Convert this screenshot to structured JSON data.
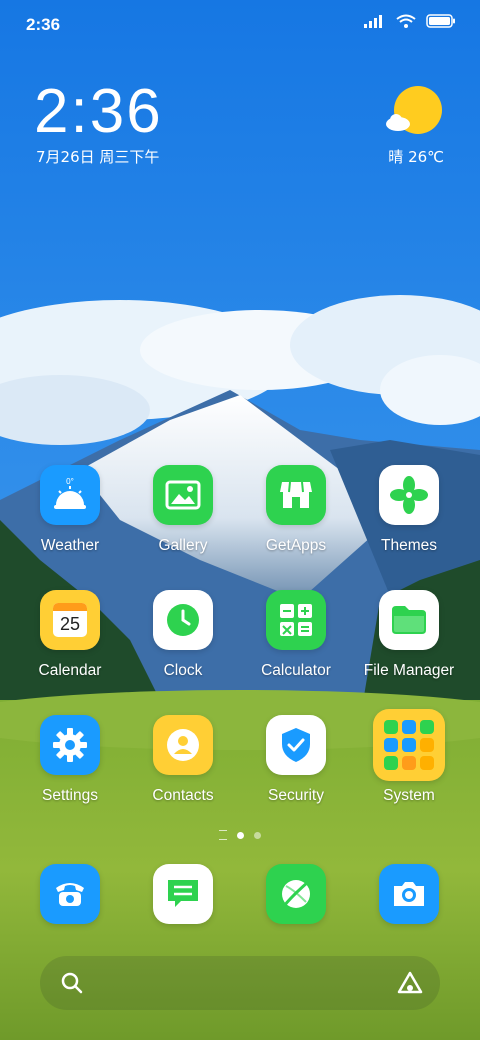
{
  "status_bar": {
    "time": "2:36"
  },
  "clock_widget": {
    "time": "2:36",
    "date": "7月26日 周三下午",
    "weather": "晴 26℃"
  },
  "apps": [
    {
      "label": "Weather",
      "icon": "weather-icon",
      "color": "#1a9bff"
    },
    {
      "label": "Gallery",
      "icon": "gallery-icon",
      "color": "#2ed24f"
    },
    {
      "label": "GetApps",
      "icon": "store-icon",
      "color": "#2ed24f"
    },
    {
      "label": "Themes",
      "icon": "themes-icon",
      "color": "#ffffff"
    },
    {
      "label": "Calendar",
      "icon": "calendar-icon",
      "color": "#ffcf35",
      "badge": "25"
    },
    {
      "label": "Clock",
      "icon": "clock-icon",
      "color": "#ffffff"
    },
    {
      "label": "Calculator",
      "icon": "calculator-icon",
      "color": "#2ed24f"
    },
    {
      "label": "File Manager",
      "icon": "folder-icon",
      "color": "#ffffff"
    },
    {
      "label": "Settings",
      "icon": "gear-icon",
      "color": "#1a9bff"
    },
    {
      "label": "Contacts",
      "icon": "contacts-icon",
      "color": "#ffcf35"
    },
    {
      "label": "Security",
      "icon": "shield-icon",
      "color": "#ffffff"
    },
    {
      "label": "System",
      "icon": "system-folder-icon",
      "color": "#ffcf35"
    }
  ],
  "dock": [
    {
      "icon": "phone-icon",
      "color": "#1a9bff"
    },
    {
      "icon": "messages-icon",
      "color": "#ffffff"
    },
    {
      "icon": "browser-icon",
      "color": "#2ed24f"
    },
    {
      "icon": "camera-icon",
      "color": "#1a9bff"
    }
  ],
  "page_indicator": {
    "pages": 2,
    "current": 1
  }
}
